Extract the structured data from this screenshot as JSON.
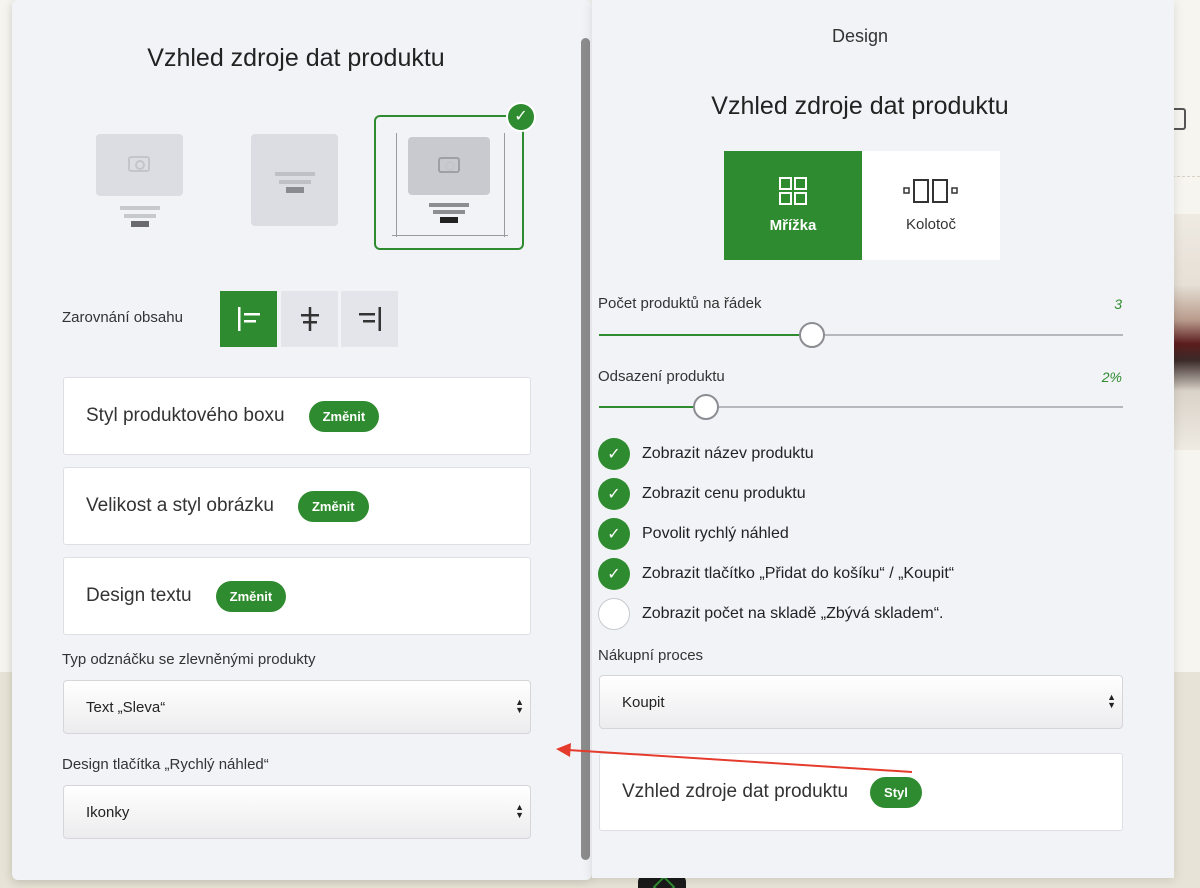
{
  "left_panel": {
    "title": "Vzhled zdroje dat produktu",
    "alignment_label": "Zarovnání obsahu",
    "cards": [
      {
        "label": "Styl produktového boxu",
        "button": "Změnit"
      },
      {
        "label": "Velikost a styl obrázku",
        "button": "Změnit"
      },
      {
        "label": "Design textu",
        "button": "Změnit"
      }
    ],
    "badge_type_label": "Typ odznáčku se zlevněnými produkty",
    "badge_type_value": "Text „Sleva“",
    "quickview_label": "Design tlačítka „Rychlý náhled“",
    "quickview_value": "Ikonky"
  },
  "right_panel": {
    "header": "Design",
    "title": "Vzhled zdroje dat produktu",
    "segments": [
      {
        "label": "Mřížka",
        "selected": true
      },
      {
        "label": "Kolotoč",
        "selected": false
      }
    ],
    "products_per_row": {
      "label": "Počet produktů na řádek",
      "value": "3"
    },
    "product_spacing": {
      "label": "Odsazení produktu",
      "value": "2%"
    },
    "checkboxes": [
      {
        "label": "Zobrazit název produktu",
        "checked": true
      },
      {
        "label": "Zobrazit cenu produktu",
        "checked": true
      },
      {
        "label": "Povolit rychlý náhled",
        "checked": true
      },
      {
        "label": "Zobrazit tlačítko „Přidat do košíku“ / „Koupit“",
        "checked": true
      },
      {
        "label": "Zobrazit počet na skladě „Zbývá skladem“.",
        "checked": false
      }
    ],
    "purchase_process_label": "Nákupní proces",
    "purchase_process_value": "Koupit",
    "style_card": {
      "label": "Vzhled zdroje dat produktu",
      "button": "Styl"
    }
  },
  "colors": {
    "accent": "#2f8b2f",
    "panel": "#f2f3f7",
    "annotation_arrow": "#e53b2c"
  }
}
